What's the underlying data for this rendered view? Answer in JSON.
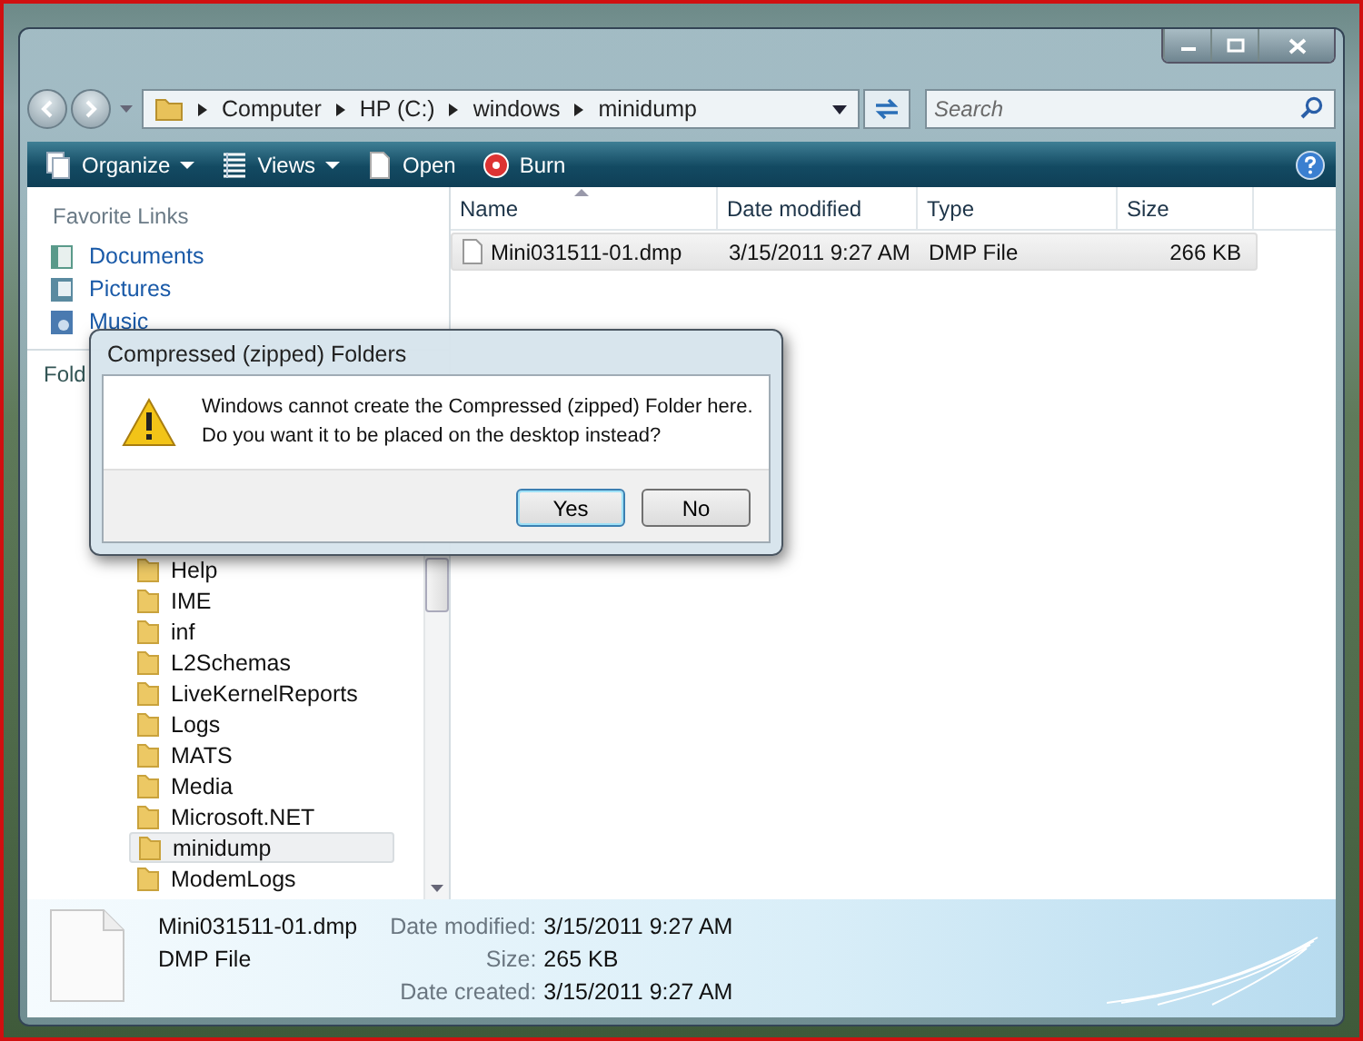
{
  "address_bar": {
    "crumbs": [
      "Computer",
      "HP (C:)",
      "windows",
      "minidump"
    ]
  },
  "search": {
    "placeholder": "Search"
  },
  "toolbar": {
    "items": [
      {
        "label": "Organize",
        "dropdown": true
      },
      {
        "label": "Views",
        "dropdown": true
      },
      {
        "label": "Open",
        "dropdown": false
      },
      {
        "label": "Burn",
        "dropdown": false
      }
    ]
  },
  "favorite_links": {
    "title": "Favorite Links",
    "items": [
      "Documents",
      "Pictures",
      "Music"
    ]
  },
  "folders": {
    "title": "Fold",
    "items": [
      {
        "label": "Help",
        "selected": false
      },
      {
        "label": "IME",
        "selected": false
      },
      {
        "label": "inf",
        "selected": false
      },
      {
        "label": "L2Schemas",
        "selected": false
      },
      {
        "label": "LiveKernelReports",
        "selected": false
      },
      {
        "label": "Logs",
        "selected": false
      },
      {
        "label": "MATS",
        "selected": false
      },
      {
        "label": "Media",
        "selected": false
      },
      {
        "label": "Microsoft.NET",
        "selected": false
      },
      {
        "label": "minidump",
        "selected": true
      },
      {
        "label": "ModemLogs",
        "selected": false
      }
    ]
  },
  "file_list": {
    "columns": [
      {
        "label": "Name",
        "sorted": true
      },
      {
        "label": "Date modified",
        "sorted": false
      },
      {
        "label": "Type",
        "sorted": false
      },
      {
        "label": "Size",
        "sorted": false
      }
    ],
    "rows": [
      {
        "name": "Mini031511-01.dmp",
        "date_modified": "3/15/2011 9:27 AM",
        "type": "DMP File",
        "size": "266 KB",
        "selected": true
      }
    ]
  },
  "details_pane": {
    "name": "Mini031511-01.dmp",
    "type": "DMP File",
    "fields": [
      {
        "label": "Date modified:",
        "value": "3/15/2011 9:27 AM"
      },
      {
        "label": "Size:",
        "value": "265 KB"
      },
      {
        "label": "Date created:",
        "value": "3/15/2011 9:27 AM"
      }
    ]
  },
  "dialog": {
    "title": "Compressed (zipped) Folders",
    "message": "Windows cannot create the Compressed (zipped) Folder here.\nDo you want it to be placed on the desktop instead?",
    "buttons": [
      {
        "label": "Yes",
        "default": true
      },
      {
        "label": "No",
        "default": false
      }
    ]
  }
}
